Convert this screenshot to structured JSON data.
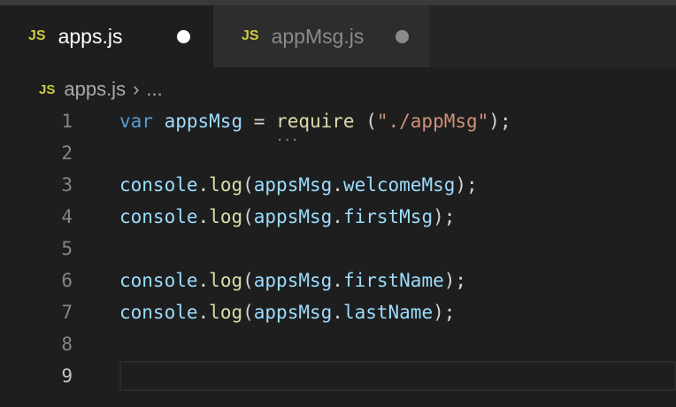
{
  "tabs": [
    {
      "label": "apps.js",
      "icon": "JS",
      "modified": true,
      "active": true
    },
    {
      "label": "appMsg.js",
      "icon": "JS",
      "modified": true,
      "active": false
    }
  ],
  "breadcrumb": {
    "icon": "JS",
    "file": "apps.js",
    "rest": "..."
  },
  "code": {
    "line_numbers": [
      "1",
      "2",
      "3",
      "4",
      "5",
      "6",
      "7",
      "8",
      "9"
    ],
    "current_line": 9,
    "l1": {
      "kw": "var",
      "v": "appsMsg",
      "eq": " = ",
      "fn": "require",
      "p1": " (",
      "str": "\"./appMsg\"",
      "p2": ");"
    },
    "l3": {
      "obj": "console",
      "dot": ".",
      "fn": "log",
      "p": "(",
      "arg": "appsMsg",
      "d": ".",
      "prop": "welcomeMsg",
      "end": ");"
    },
    "l4": {
      "obj": "console",
      "dot": ".",
      "fn": "log",
      "p": "(",
      "arg": "appsMsg",
      "d": ".",
      "prop": "firstMsg",
      "end": ");"
    },
    "l6": {
      "obj": "console",
      "dot": ".",
      "fn": "log",
      "p": "(",
      "arg": "appsMsg",
      "d": ".",
      "prop": "firstName",
      "end": ");"
    },
    "l7": {
      "obj": "console",
      "dot": ".",
      "fn": "log",
      "p": "(",
      "arg": "appsMsg",
      "d": ".",
      "prop": "lastName",
      "end": ");"
    }
  }
}
